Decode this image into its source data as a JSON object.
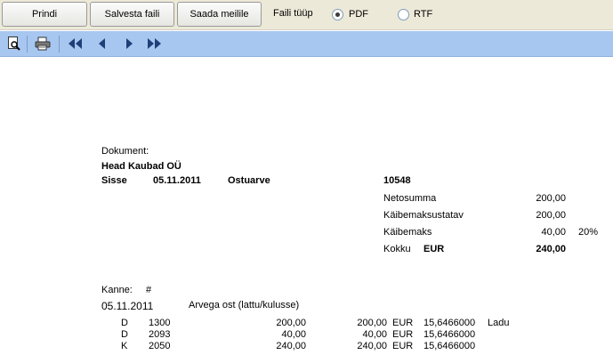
{
  "toolbar": {
    "print_label": "Prindi",
    "save_label": "Salvesta faili",
    "mail_label": "Saada meilile",
    "filetype_label": "Faili tüüp",
    "pdf_label": "PDF",
    "rtf_label": "RTF",
    "selected_filetype": "PDF"
  },
  "preview_toolbar": {
    "icons": [
      "page-preview-icon",
      "printer-icon",
      "first-page-icon",
      "previous-page-icon",
      "next-page-icon",
      "last-page-icon"
    ]
  },
  "document": {
    "dokument_label": "Dokument:",
    "company": "Head Kaubad OÜ",
    "direction": "Sisse",
    "date": "05.11.2011",
    "doc_type": "Ostuarve",
    "doc_number": "10548",
    "summary": {
      "netosumma_label": "Netosumma",
      "netosumma_value": "200,00",
      "kaibemaksustatav_label": "Käibemaksustatav",
      "kaibemaksustatav_value": "200,00",
      "kaibemaks_label": "Käibemaks",
      "kaibemaks_value": "40,00",
      "kaibemaks_rate": "20%",
      "kokku_label": "Kokku",
      "currency": "EUR",
      "kokku_value": "240,00"
    },
    "kanne_label": "Kanne:",
    "kanne_hash": "#",
    "entry_date": "05.11.2011",
    "entry_description": "Arvega ost (lattu/kulusse)",
    "entries": [
      {
        "side": "D",
        "account": "1300",
        "amount": "200,00",
        "currency_amount": "200,00",
        "currency": "EUR",
        "rate": "15,6466000",
        "note": "Ladu"
      },
      {
        "side": "D",
        "account": "2093",
        "amount": "40,00",
        "currency_amount": "40,00",
        "currency": "EUR",
        "rate": "15,6466000",
        "note": ""
      },
      {
        "side": "K",
        "account": "2050",
        "amount": "240,00",
        "currency_amount": "240,00",
        "currency": "EUR",
        "rate": "15,6466000",
        "note": ""
      }
    ]
  }
}
